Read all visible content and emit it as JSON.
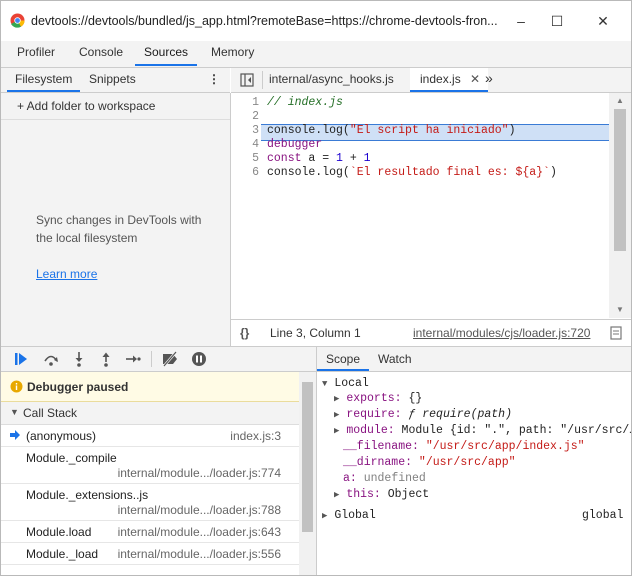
{
  "window": {
    "title": "devtools://devtools/bundled/js_app.html?remoteBase=https://chrome-devtools-fron...",
    "minimize": "–",
    "maximize": "☐",
    "close": "✕"
  },
  "top_tabs": [
    "Profiler",
    "Console",
    "Sources",
    "Memory"
  ],
  "nav": {
    "tabs": [
      "Filesystem",
      "Snippets"
    ],
    "more": "⋮",
    "add_folder": "+ Add folder to workspace",
    "sync_message": "Sync changes in DevTools with the local filesystem",
    "learn_more": "Learn more"
  },
  "editor": {
    "tabs": [
      {
        "label": "internal/async_hooks.js"
      },
      {
        "label": "index.js",
        "close": "✕"
      }
    ],
    "more_tabs": "»",
    "lines": [
      {
        "n": "1",
        "text": "// index.js"
      },
      {
        "n": "2",
        "text": ""
      },
      {
        "n": "3",
        "text": "console.log(\"El script ha iniciado\")"
      },
      {
        "n": "4",
        "text": "debugger"
      },
      {
        "n": "5",
        "text": "const a = 1 + 1"
      },
      {
        "n": "6",
        "text": "console.log(`El resultado final es: ${a}`)"
      }
    ],
    "status": {
      "braces": "{}",
      "position": "Line 3, Column 1",
      "source": "internal/modules/cjs/loader.js:720"
    }
  },
  "debugger": {
    "paused": "Debugger paused",
    "call_stack_title": "Call Stack",
    "frames": [
      {
        "name": "(anonymous)",
        "loc": "index.js:3"
      },
      {
        "name": "Module._compile",
        "loc": "internal/module.../loader.js:774"
      },
      {
        "name": "Module._extensions..js",
        "loc": "internal/module.../loader.js:788"
      },
      {
        "name": "Module.load",
        "loc": "internal/module.../loader.js:643"
      },
      {
        "name": "Module._load",
        "loc": "internal/module.../loader.js:556"
      }
    ]
  },
  "scope": {
    "tabs": [
      "Scope",
      "Watch"
    ],
    "local_label": "Local",
    "exports_key": "exports:",
    "exports_val": "{}",
    "require_key": "require:",
    "require_val": "ƒ require(path)",
    "module_key": "module:",
    "module_val": "Module {id: \".\", path: \"/usr/src/…",
    "filename_key": "__filename:",
    "filename_val": "\"/usr/src/app/index.js\"",
    "dirname_key": "__dirname:",
    "dirname_val": "\"/usr/src/app\"",
    "a_key": "a:",
    "a_val": "undefined",
    "this_key": "this:",
    "this_val": "Object",
    "global_label": "Global",
    "global_val": "global"
  }
}
